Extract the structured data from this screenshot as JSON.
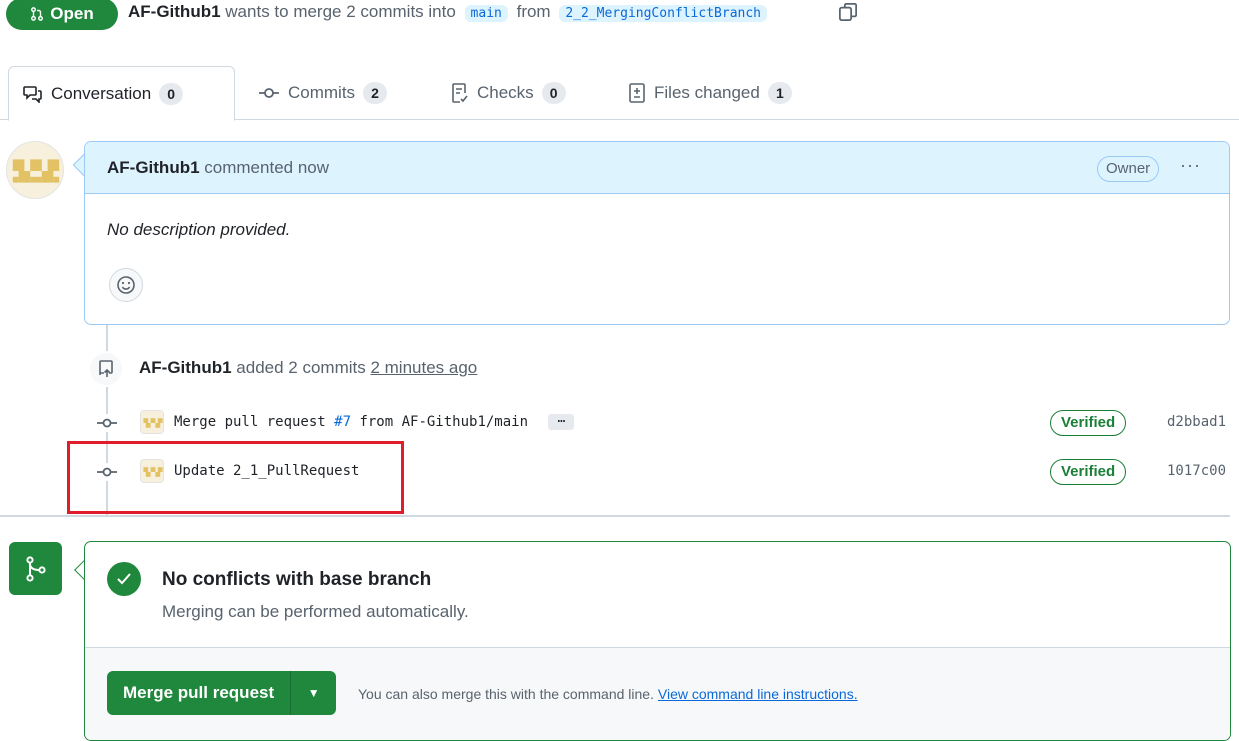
{
  "header": {
    "state_label": "Open",
    "author": "AF-Github1",
    "summary": "wants to merge 2 commits into",
    "base_branch": "main",
    "from_word": "from",
    "head_branch": "2_2_MergingConflictBranch"
  },
  "tabs": [
    {
      "label": "Conversation",
      "count": "0",
      "icon": "comment-discussion-icon"
    },
    {
      "label": "Commits",
      "count": "2",
      "icon": "git-commit-icon"
    },
    {
      "label": "Checks",
      "count": "0",
      "icon": "checklist-icon"
    },
    {
      "label": "Files changed",
      "count": "1",
      "icon": "file-diff-icon"
    }
  ],
  "comment": {
    "author": "AF-Github1",
    "action": "commented now",
    "badge": "Owner",
    "more": "···",
    "body": "No description provided."
  },
  "commits_event": {
    "author": "AF-Github1",
    "action": "added 2 commits",
    "time": "2 minutes ago"
  },
  "commits": [
    {
      "prefix": "Merge pull request ",
      "pr": "#7",
      "suffix": " from AF-Github1/main",
      "has_more": true,
      "badge": "Verified",
      "sha": "d2bbad1"
    },
    {
      "prefix": "Update 2_1_PullRequest",
      "pr": "",
      "suffix": "",
      "has_more": false,
      "badge": "Verified",
      "sha": "1017c00"
    }
  ],
  "merge": {
    "title": "No conflicts with base branch",
    "subtitle": "Merging can be performed automatically.",
    "button_label": "Merge pull request",
    "hint_text": "You can also merge this with the command line.",
    "hint_link": "View command line instructions."
  },
  "colors": {
    "accent_green": "#1f883d",
    "link_blue": "#0969da",
    "highlight_red": "#e01e2b"
  }
}
